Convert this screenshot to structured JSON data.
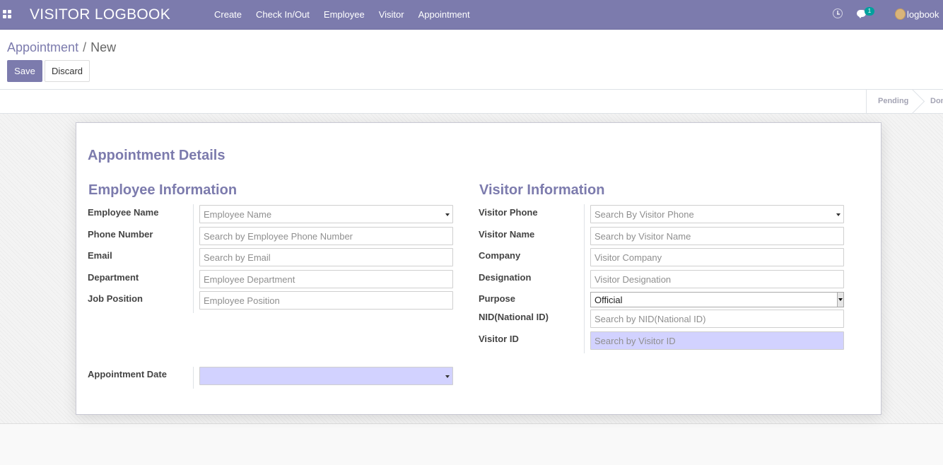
{
  "app": {
    "title": "VISITOR LOGBOOK"
  },
  "menu": [
    "Create",
    "Check In/Out",
    "Employee",
    "Visitor",
    "Appointment"
  ],
  "systray": {
    "message_count": "1",
    "user": "logbook"
  },
  "breadcrumb": {
    "parent": "Appointment",
    "separator": "/",
    "current": "New"
  },
  "buttons": {
    "save": "Save",
    "discard": "Discard"
  },
  "statusbar": {
    "stages": [
      "Pending",
      "Done"
    ]
  },
  "form": {
    "title": "Appointment Details",
    "employee": {
      "title": "Employee Information",
      "fields": [
        {
          "label": "Employee Name",
          "placeholder": "Employee Name"
        },
        {
          "label": "Phone Number",
          "placeholder": "Search by Employee Phone Number"
        },
        {
          "label": "Email",
          "placeholder": "Search by Email"
        },
        {
          "label": "Department",
          "placeholder": "Employee Department"
        },
        {
          "label": "Job Position",
          "placeholder": "Employee Position"
        }
      ]
    },
    "appointment_date": {
      "label": "Appointment Date",
      "value": ""
    },
    "visitor": {
      "title": "Visitor Information",
      "fields": [
        {
          "label": "Visitor Phone",
          "placeholder": "Search By Visitor Phone"
        },
        {
          "label": "Visitor Name",
          "placeholder": "Search by Visitor Name"
        },
        {
          "label": "Company",
          "placeholder": "Visitor Company"
        },
        {
          "label": "Designation",
          "placeholder": "Visitor Designation"
        },
        {
          "label": "Purpose",
          "value": "Official"
        },
        {
          "label": "NID(National ID)",
          "placeholder": "Search by NID(National ID)"
        },
        {
          "label": "Visitor ID",
          "placeholder": "Search by Visitor ID"
        }
      ]
    }
  },
  "colors": {
    "brand": "#7c7bad",
    "required_field": "#d2d2ff",
    "badge": "#00a09d"
  }
}
